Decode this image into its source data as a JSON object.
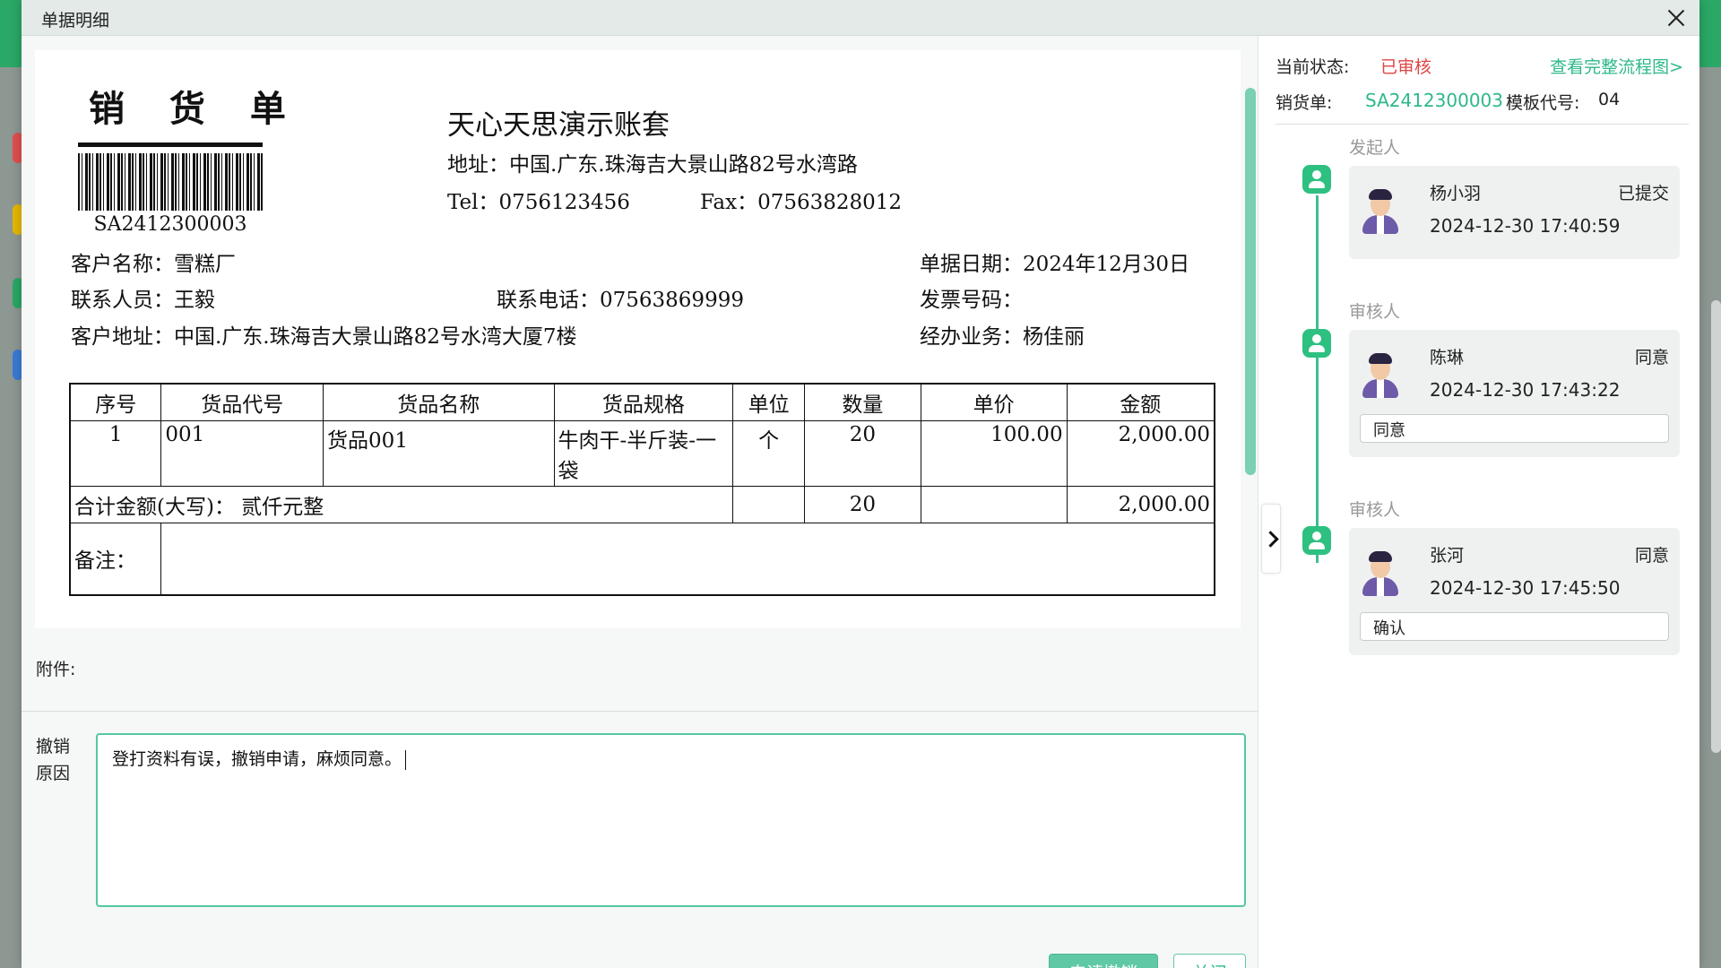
{
  "window": {
    "title": "单据明细"
  },
  "document": {
    "heading": "销 货 单",
    "barcode_number": "SA2412300003",
    "company_name": "天心天思演示账套",
    "address": "地址：中国.广东.珠海吉大景山路82号水湾路",
    "tel": "Tel：0756123456",
    "fax": "Fax：07563828012",
    "customer_name": "客户名称：雪糕厂",
    "contact_person": "联系人员：王毅",
    "contact_phone": "联系电话：07563869999",
    "customer_address": "客户地址：中国.广东.珠海吉大景山路82号水湾大厦7楼",
    "doc_date": "单据日期：2024年12月30日",
    "invoice_no": "发票号码：",
    "handler": "经办业务：杨佳丽",
    "table": {
      "headers": [
        "序号",
        "货品代号",
        "货品名称",
        "货品规格",
        "单位",
        "数量",
        "单价",
        "金额"
      ],
      "rows": [
        [
          "1",
          "001",
          "货品001",
          "牛肉干-半斤装-一袋",
          "个",
          "20",
          "100.00",
          "2,000.00"
        ]
      ],
      "total_label": "合计金额(大写)：  贰仟元整",
      "total_qty": "20",
      "total_amount": "2,000.00",
      "remark_label": "备注："
    }
  },
  "attachment_label": "附件:",
  "revoke": {
    "label_line1": "撤销",
    "label_line2": "原因",
    "text": "登打资料有误，撤销申请，麻烦同意。",
    "submit_label": "申请撤销",
    "close_label": "关闭"
  },
  "sidebar": {
    "status_label": "当前状态:",
    "status_value": "已审核",
    "flow_link": "查看完整流程图>",
    "doc_label": "销货单:",
    "doc_number": "SA2412300003",
    "template_label": "模板代号:",
    "template_value": "04",
    "steps": [
      {
        "role": "发起人",
        "name": "杨小羽",
        "state": "已提交",
        "time": "2024-12-30 17:40:59",
        "comment": ""
      },
      {
        "role": "审核人",
        "name": "陈琳",
        "state": "同意",
        "time": "2024-12-30 17:43:22",
        "comment": "同意"
      },
      {
        "role": "审核人",
        "name": "张河",
        "state": "同意",
        "time": "2024-12-30 17:45:50",
        "comment": "确认"
      }
    ]
  },
  "colors": {
    "accent": "#2eb88b",
    "status_red": "#e04545",
    "primary_button": "#5fc9a6"
  }
}
